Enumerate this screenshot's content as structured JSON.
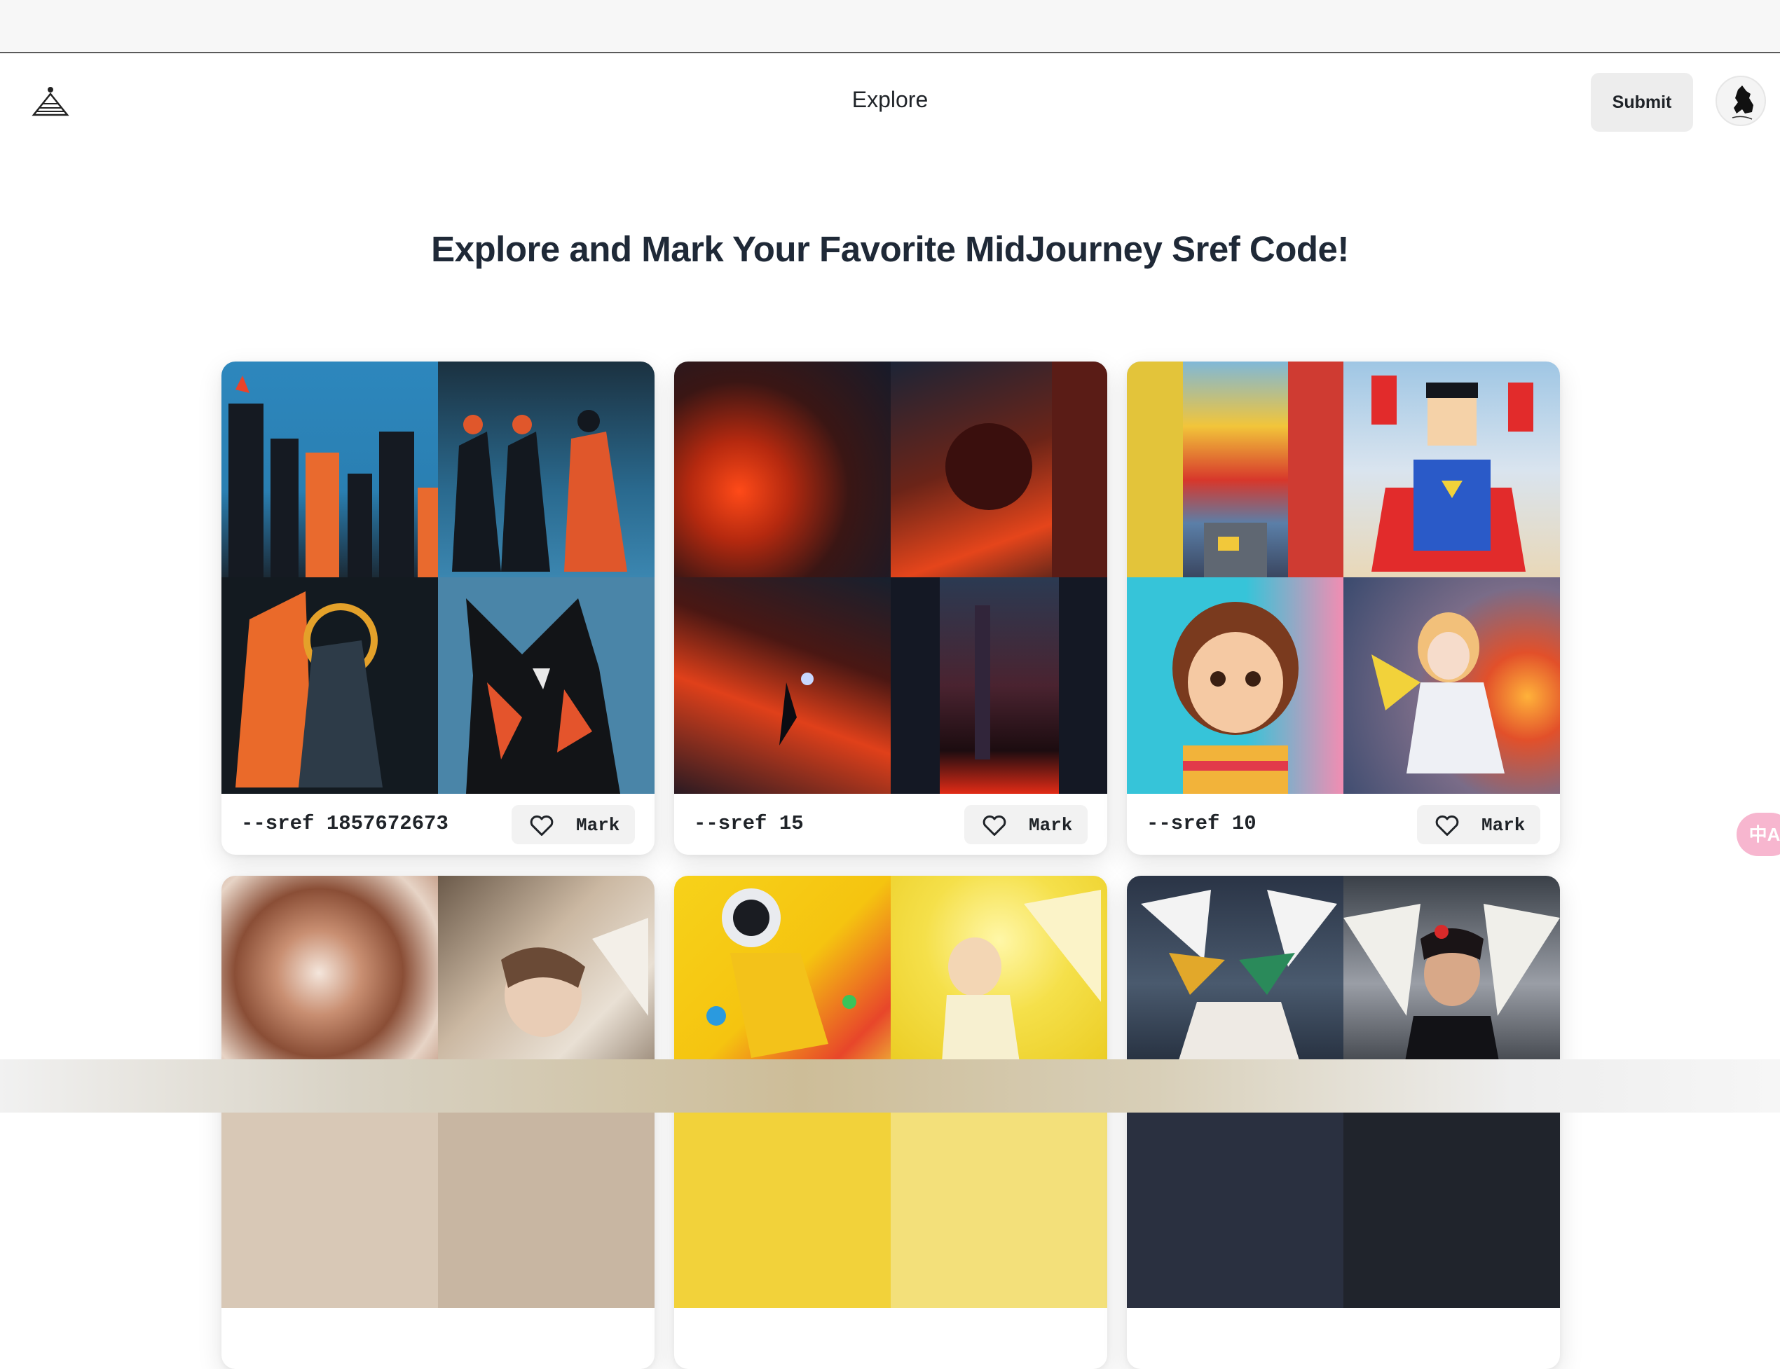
{
  "nav": {
    "logo_icon": "pyramid-logo-icon",
    "title": "Explore",
    "submit_label": "Submit",
    "avatar_icon": "user-avatar"
  },
  "headline": "Explore and Mark Your Favorite MidJourney Sref Code!",
  "cards": [
    {
      "sref": "--sref 1857672673",
      "mark_label": "Mark",
      "heart_icon": "heart-outline-icon"
    },
    {
      "sref": "--sref 15",
      "mark_label": "Mark",
      "heart_icon": "heart-outline-icon"
    },
    {
      "sref": "--sref 10",
      "mark_label": "Mark",
      "heart_icon": "heart-outline-icon"
    }
  ],
  "translate_button": {
    "icon": "translate-icon",
    "label": "中A"
  },
  "colors": {
    "submit_bg": "#ededed",
    "mark_bg": "#f2f2f2",
    "translate_bg": "#f7b6cf",
    "headline": "#1f2937"
  }
}
